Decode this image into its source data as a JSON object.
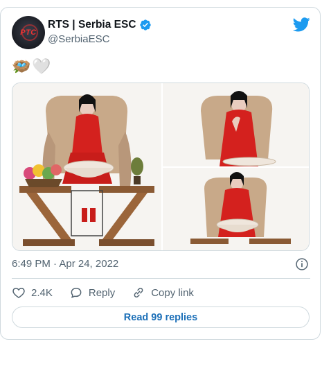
{
  "tweet": {
    "author_name": "RTS | Serbia ESC",
    "handle": "@SerbiaESC",
    "avatar_text": "PTC",
    "text_emojis": [
      "🪺",
      "🤍"
    ],
    "timestamp": "6:49 PM · Apr 24, 2022",
    "verified": true
  },
  "actions": {
    "likes_count": "2.4K",
    "reply_label": "Reply",
    "copy_link_label": "Copy link"
  },
  "read_replies_label": "Read 99 replies",
  "icons": {
    "brand": "twitter-bird-icon",
    "verified": "verified-badge-icon",
    "info": "info-icon",
    "like": "heart-icon",
    "reply": "speech-bubble-icon",
    "copy": "link-icon"
  },
  "colors": {
    "twitter_blue": "#1d9bf0",
    "link_blue": "#1d70b8",
    "muted_text": "#536471",
    "border": "#cfd9de"
  }
}
